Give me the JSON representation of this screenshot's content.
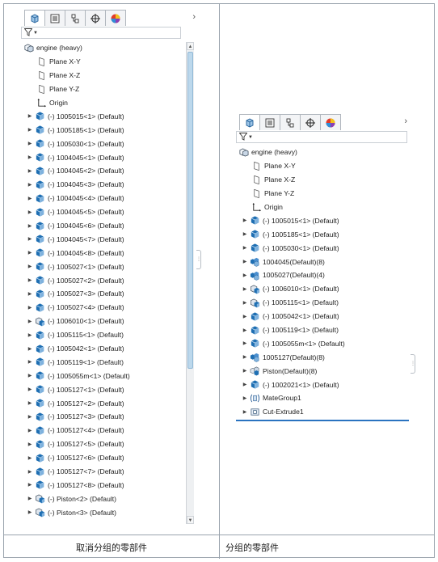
{
  "captions": {
    "left": "取消分组的零部件",
    "right": "分组的零部件"
  },
  "tabs": [
    {
      "name": "feature-tree-tab",
      "icon": "feature-manager-icon"
    },
    {
      "name": "property-tab",
      "icon": "property-manager-icon"
    },
    {
      "name": "configuration-tab",
      "icon": "configuration-manager-icon"
    },
    {
      "name": "dimxpert-tab",
      "icon": "crosshair-icon"
    },
    {
      "name": "appearance-tab",
      "icon": "appearance-sphere-icon"
    }
  ],
  "tab_overflow": "›",
  "left_tree": {
    "items": [
      {
        "label": "engine (heavy)",
        "icon": "assembly-icon",
        "expander": false,
        "indent": 0
      },
      {
        "label": "Plane X-Y",
        "icon": "plane-icon",
        "expander": false,
        "indent": 1
      },
      {
        "label": "Plane X-Z",
        "icon": "plane-icon",
        "expander": false,
        "indent": 1
      },
      {
        "label": "Plane Y-Z",
        "icon": "plane-icon",
        "expander": false,
        "indent": 1
      },
      {
        "label": "Origin",
        "icon": "origin-icon",
        "expander": false,
        "indent": 1
      },
      {
        "label": "(-) 1005015<1> (Default)",
        "icon": "part-icon",
        "expander": true,
        "indent": 1
      },
      {
        "label": "(-) 1005185<1> (Default)",
        "icon": "part-icon",
        "expander": true,
        "indent": 1
      },
      {
        "label": "(-) 1005030<1> (Default)",
        "icon": "part-icon",
        "expander": true,
        "indent": 1
      },
      {
        "label": "(-) 1004045<1> (Default)",
        "icon": "part-icon",
        "expander": true,
        "indent": 1
      },
      {
        "label": "(-) 1004045<2> (Default)",
        "icon": "part-icon",
        "expander": true,
        "indent": 1
      },
      {
        "label": "(-) 1004045<3> (Default)",
        "icon": "part-icon",
        "expander": true,
        "indent": 1
      },
      {
        "label": "(-) 1004045<4> (Default)",
        "icon": "part-icon",
        "expander": true,
        "indent": 1
      },
      {
        "label": "(-) 1004045<5> (Default)",
        "icon": "part-icon",
        "expander": true,
        "indent": 1
      },
      {
        "label": "(-) 1004045<6> (Default)",
        "icon": "part-icon",
        "expander": true,
        "indent": 1
      },
      {
        "label": "(-) 1004045<7> (Default)",
        "icon": "part-icon",
        "expander": true,
        "indent": 1
      },
      {
        "label": "(-) 1004045<8> (Default)",
        "icon": "part-icon",
        "expander": true,
        "indent": 1
      },
      {
        "label": "(-) 1005027<1> (Default)",
        "icon": "part-icon",
        "expander": true,
        "indent": 1
      },
      {
        "label": "(-) 1005027<2> (Default)",
        "icon": "part-icon",
        "expander": true,
        "indent": 1
      },
      {
        "label": "(-) 1005027<3> (Default)",
        "icon": "part-icon",
        "expander": true,
        "indent": 1
      },
      {
        "label": "(-) 1005027<4> (Default)",
        "icon": "part-icon",
        "expander": true,
        "indent": 1
      },
      {
        "label": "(-) 1006010<1> (Default)",
        "icon": "subassembly-icon",
        "expander": true,
        "indent": 1
      },
      {
        "label": "(-) 1005115<1> (Default)",
        "icon": "part-icon",
        "expander": true,
        "indent": 1
      },
      {
        "label": "(-) 1005042<1> (Default)",
        "icon": "part-icon",
        "expander": true,
        "indent": 1
      },
      {
        "label": "(-) 1005119<1> (Default)",
        "icon": "part-icon",
        "expander": true,
        "indent": 1
      },
      {
        "label": "(-) 1005055m<1> (Default)",
        "icon": "part-icon",
        "expander": true,
        "indent": 1
      },
      {
        "label": "(-) 1005127<1> (Default)",
        "icon": "part-icon",
        "expander": true,
        "indent": 1
      },
      {
        "label": "(-) 1005127<2> (Default)",
        "icon": "part-icon",
        "expander": true,
        "indent": 1
      },
      {
        "label": "(-) 1005127<3> (Default)",
        "icon": "part-icon",
        "expander": true,
        "indent": 1
      },
      {
        "label": "(-) 1005127<4> (Default)",
        "icon": "part-icon",
        "expander": true,
        "indent": 1
      },
      {
        "label": "(-) 1005127<5> (Default)",
        "icon": "part-icon",
        "expander": true,
        "indent": 1
      },
      {
        "label": "(-) 1005127<6> (Default)",
        "icon": "part-icon",
        "expander": true,
        "indent": 1
      },
      {
        "label": "(-) 1005127<7> (Default)",
        "icon": "part-icon",
        "expander": true,
        "indent": 1
      },
      {
        "label": "(-) 1005127<8> (Default)",
        "icon": "part-icon",
        "expander": true,
        "indent": 1
      },
      {
        "label": "(-) Piston<2> (Default)",
        "icon": "subassembly-icon",
        "expander": true,
        "indent": 1
      },
      {
        "label": "(-) Piston<3> (Default)",
        "icon": "subassembly-icon",
        "expander": true,
        "indent": 1
      }
    ]
  },
  "right_tree": {
    "items": [
      {
        "label": "engine (heavy)",
        "icon": "assembly-icon",
        "expander": false,
        "indent": 0
      },
      {
        "label": "Plane X-Y",
        "icon": "plane-icon",
        "expander": false,
        "indent": 1
      },
      {
        "label": "Plane X-Z",
        "icon": "plane-icon",
        "expander": false,
        "indent": 1
      },
      {
        "label": "Plane Y-Z",
        "icon": "plane-icon",
        "expander": false,
        "indent": 1
      },
      {
        "label": "Origin",
        "icon": "origin-icon",
        "expander": false,
        "indent": 1
      },
      {
        "label": "(-) 1005015<1> (Default)",
        "icon": "part-icon",
        "expander": true,
        "indent": 1
      },
      {
        "label": "(-) 1005185<1> (Default)",
        "icon": "part-icon",
        "expander": true,
        "indent": 1
      },
      {
        "label": "(-) 1005030<1> (Default)",
        "icon": "part-icon",
        "expander": true,
        "indent": 1
      },
      {
        "label": "1004045(Default)(8)",
        "icon": "group-icon",
        "expander": true,
        "indent": 1
      },
      {
        "label": "1005027(Default)(4)",
        "icon": "group-icon",
        "expander": true,
        "indent": 1
      },
      {
        "label": "(-) 1006010<1> (Default)",
        "icon": "subassembly-icon",
        "expander": true,
        "indent": 1
      },
      {
        "label": "(-) 1005115<1> (Default)",
        "icon": "subassembly-icon",
        "expander": true,
        "indent": 1
      },
      {
        "label": "(-) 1005042<1> (Default)",
        "icon": "part-icon",
        "expander": true,
        "indent": 1
      },
      {
        "label": "(-) 1005119<1> (Default)",
        "icon": "part-icon",
        "expander": true,
        "indent": 1
      },
      {
        "label": "(-) 1005055m<1> (Default)",
        "icon": "part-icon",
        "expander": true,
        "indent": 1
      },
      {
        "label": "1005127(Default)(8)",
        "icon": "group-icon",
        "expander": true,
        "indent": 1
      },
      {
        "label": "Piston(Default)(8)",
        "icon": "subassembly-group-icon",
        "expander": true,
        "indent": 1
      },
      {
        "label": "(-) 1002021<1> (Default)",
        "icon": "part-icon",
        "expander": true,
        "indent": 1
      },
      {
        "label": "MateGroup1",
        "icon": "mate-group-icon",
        "expander": true,
        "indent": 1
      },
      {
        "label": "Cut-Extrude1",
        "icon": "cut-extrude-icon",
        "expander": true,
        "indent": 1
      }
    ]
  },
  "left_scroll": {
    "up": "▲",
    "down": "▼"
  },
  "grip_glyph": "⋮",
  "colors": {
    "part_blue": "#1f6fb3",
    "part_light": "#7fb2de",
    "accent": "#2a73c0"
  }
}
